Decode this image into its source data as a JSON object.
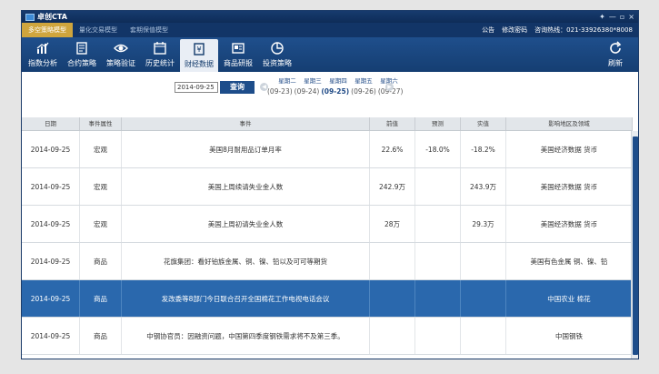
{
  "app": {
    "title": "卓创CTA",
    "min_label": "—",
    "restore_label": "▫",
    "close_label": "×",
    "pin_label": "✦"
  },
  "menu": {
    "items": [
      "多空策略模型",
      "量化交易模型",
      "套期保值模型"
    ],
    "announce": "公告",
    "change_password": "修改密码",
    "hotline": "咨询热线：021-33926380*8008"
  },
  "toolbar": {
    "items": [
      {
        "label": "指数分析",
        "icon": "chart-icon"
      },
      {
        "label": "合约策略",
        "icon": "document-icon"
      },
      {
        "label": "策略验证",
        "icon": "eye-icon"
      },
      {
        "label": "历史统计",
        "icon": "calendar-icon"
      },
      {
        "label": "财经数据",
        "icon": "finance-icon"
      },
      {
        "label": "商品研报",
        "icon": "report-icon"
      },
      {
        "label": "投资策略",
        "icon": "strategy-icon"
      }
    ],
    "refresh_label": "刷新"
  },
  "search": {
    "date_value": "2014-09-25",
    "query_label": "查询"
  },
  "week": {
    "days": [
      "星期二",
      "星期三",
      "星期四",
      "星期五",
      "星期六"
    ],
    "dates": [
      "(09-23)",
      "(09-24)",
      "(09-25)",
      "(09-26)",
      "(09-27)"
    ],
    "selected_index": 2
  },
  "table": {
    "headers": [
      "日期",
      "事件属性",
      "事件",
      "前值",
      "预测",
      "实值",
      "影响地区及领域"
    ],
    "rows": [
      {
        "date": "2014-09-25",
        "type": "宏观",
        "event": "美国8月耐用品订单月率",
        "prev": "22.6%",
        "forecast": "-18.0%",
        "actual": "-18.2%",
        "area": "美国经济数据 货币"
      },
      {
        "date": "2014-09-25",
        "type": "宏观",
        "event": "美国上周续请失业金人数",
        "prev": "242.9万",
        "forecast": "",
        "actual": "243.9万",
        "area": "美国经济数据 货币"
      },
      {
        "date": "2014-09-25",
        "type": "宏观",
        "event": "美国上周初请失业金人数",
        "prev": "28万",
        "forecast": "",
        "actual": "29.3万",
        "area": "美国经济数据 货币"
      },
      {
        "date": "2014-09-25",
        "type": "商品",
        "event": "花旗集团：看好铂族金属、铜、镍、铅以及可可等期货",
        "prev": "",
        "forecast": "",
        "actual": "",
        "area": "美国有色金属 铜、镍、铅"
      },
      {
        "date": "2014-09-25",
        "type": "商品",
        "event": "发改委等8部门今日联合召开全国棉花工作电视电话会议",
        "prev": "",
        "forecast": "",
        "actual": "",
        "area": "中国农业 棉花"
      },
      {
        "date": "2014-09-25",
        "type": "商品",
        "event": "中钢协官员：因融资问题，中国第四季度钢铁需求将不及第三季。",
        "prev": "",
        "forecast": "",
        "actual": "",
        "area": "中国钢铁"
      }
    ],
    "selected_row": 4
  }
}
